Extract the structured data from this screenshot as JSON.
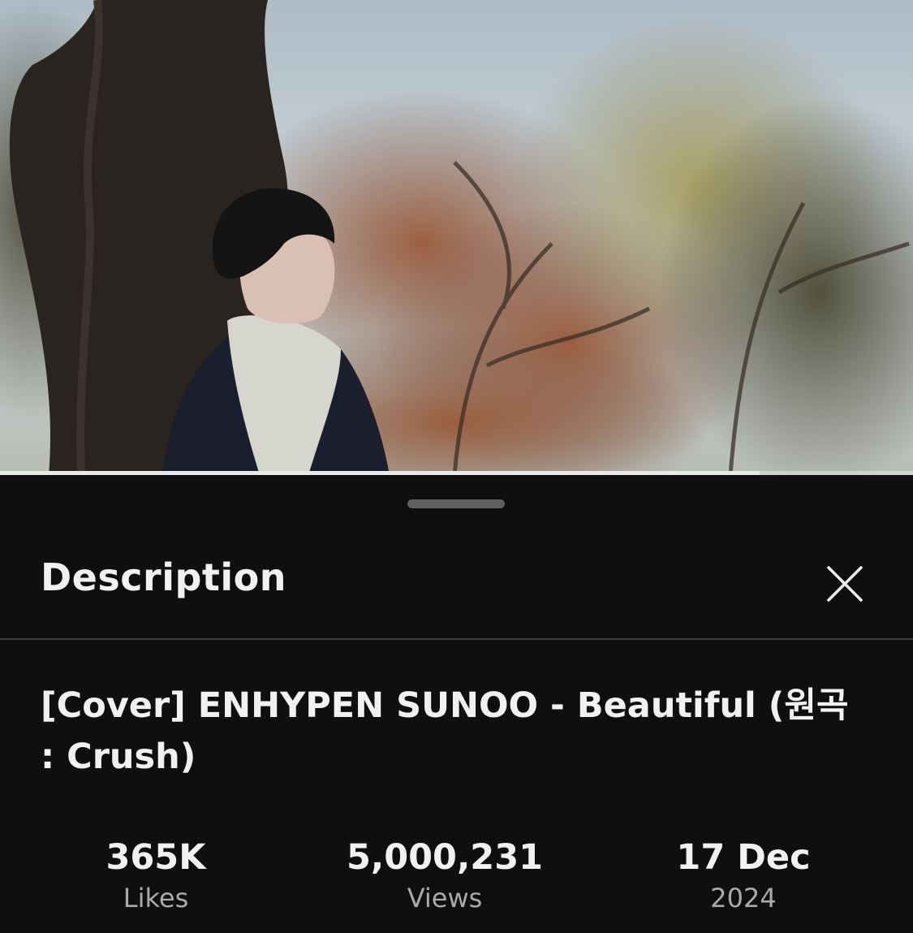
{
  "video": {
    "progress_fraction": 0.832
  },
  "sheet": {
    "title": "Description",
    "close_icon": "close-icon"
  },
  "video_info": {
    "title": "[Cover] ENHYPEN SUNOO - Beautiful (원곡 : Crush)"
  },
  "stats": {
    "likes": {
      "value": "365K",
      "label": "Likes"
    },
    "views": {
      "value": "5,000,231",
      "label": "Views"
    },
    "date": {
      "value": "17 Dec",
      "label": "2024"
    }
  },
  "colors": {
    "background": "#0f0f0f",
    "text_primary": "#f1f1f1",
    "text_secondary": "#aaaaaa"
  }
}
